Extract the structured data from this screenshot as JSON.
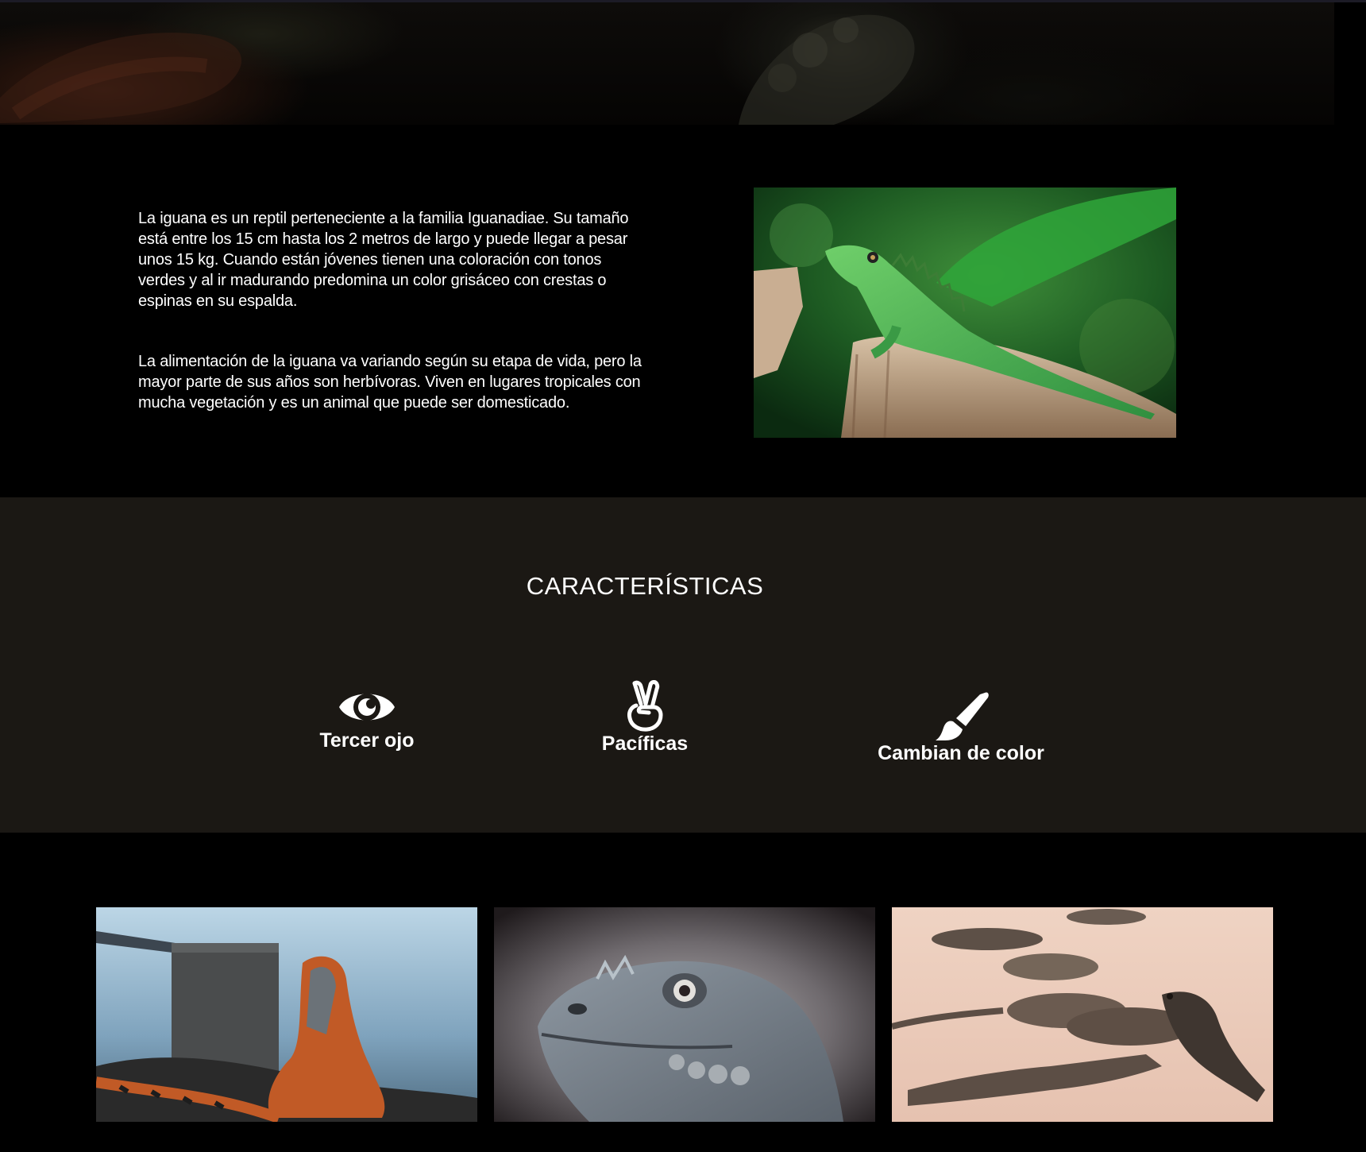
{
  "intro": {
    "paragraph_1": "La iguana es un reptil perteneciente a la familia Iguanadiae. Su tamaño está entre los 15 cm hasta los 2 metros de largo y puede llegar a pesar unos 15 kg. Cuando están jóvenes tienen una coloración con tonos verdes y al ir madurando predomina un color grisáceo con crestas o espinas en su espalda.",
    "paragraph_2": "La alimentación de la iguana va variando según su etapa de vida, pero la mayor parte de sus años son herbívoras. Viven en lugares tropicales con mucha vegetación y es un animal que puede ser domesticado."
  },
  "features": {
    "title": "CARACTERÍSTICAS",
    "items": [
      {
        "icon": "eye-icon",
        "label": "Tercer ojo"
      },
      {
        "icon": "peace-hand-icon",
        "label": "Pacíficas"
      },
      {
        "icon": "paint-brush-icon",
        "label": "Cambian de color"
      }
    ]
  },
  "colors": {
    "page_background": "#000000",
    "features_background": "#1b1814",
    "text": "#ffffff"
  }
}
